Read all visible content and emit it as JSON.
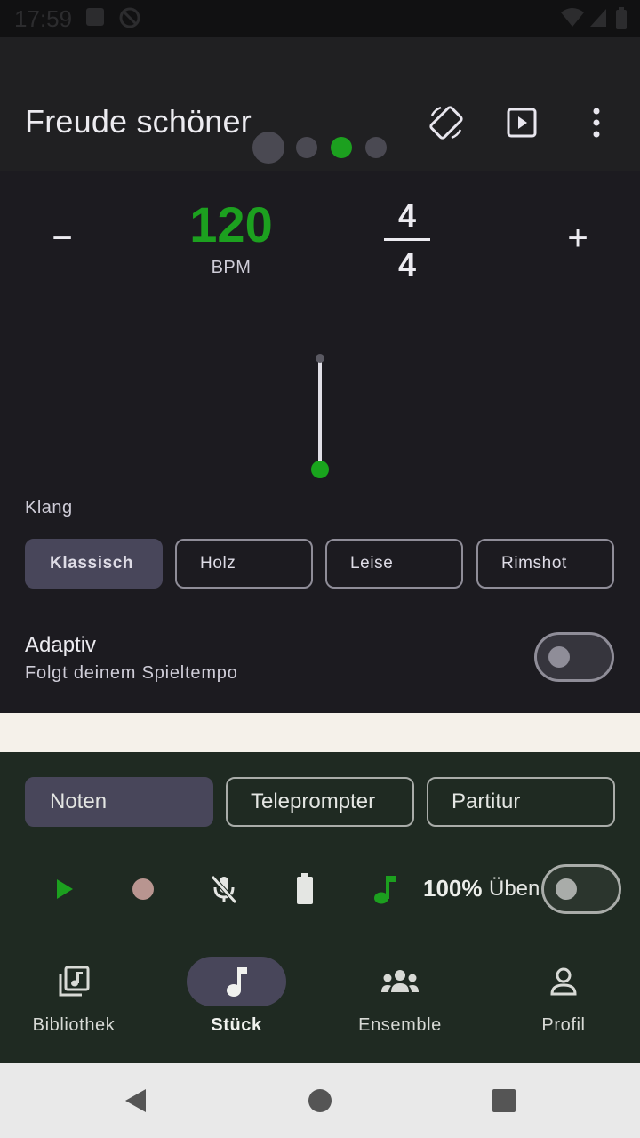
{
  "status_bar": {
    "time": "17:59"
  },
  "app_bar": {
    "title": "Freude schöner",
    "icons": [
      "screen-rotation-icon",
      "play-box-icon",
      "more-vert-icon"
    ]
  },
  "metronome": {
    "minus_label": "−",
    "plus_label": "+",
    "bpm": "120",
    "bpm_unit": "BPM",
    "time_signature": {
      "numerator": "4",
      "denominator": "4"
    },
    "active_beat_index": 2,
    "accent_color": "#1ca01f"
  },
  "klang": {
    "label": "Klang",
    "options": [
      "Klassisch",
      "Holz",
      "Leise",
      "Rimshot"
    ],
    "selected": "Klassisch"
  },
  "adaptiv": {
    "title": "Adaptiv",
    "subtitle": "Folgt deinem Spieltempo",
    "enabled": false
  },
  "view_tabs": {
    "options": [
      "Noten",
      "Teleprompter",
      "Partitur"
    ],
    "selected": "Noten"
  },
  "controls": {
    "icons": [
      "play-icon",
      "record-icon",
      "mic-off-icon",
      "battery-icon",
      "music-note-icon"
    ],
    "play_color": "#1ca01f",
    "record_color": "#b89590",
    "percent": "100%",
    "practice_label": "Üben",
    "practice_enabled": false
  },
  "bottom_nav": {
    "items": [
      {
        "label": "Bibliothek",
        "icon": "library-music-icon"
      },
      {
        "label": "Stück",
        "icon": "music-note-icon"
      },
      {
        "label": "Ensemble",
        "icon": "groups-icon"
      },
      {
        "label": "Profil",
        "icon": "person-icon"
      }
    ],
    "selected": "Stück"
  },
  "system_nav": {
    "icons": [
      "back-icon",
      "home-icon",
      "recents-icon"
    ]
  }
}
